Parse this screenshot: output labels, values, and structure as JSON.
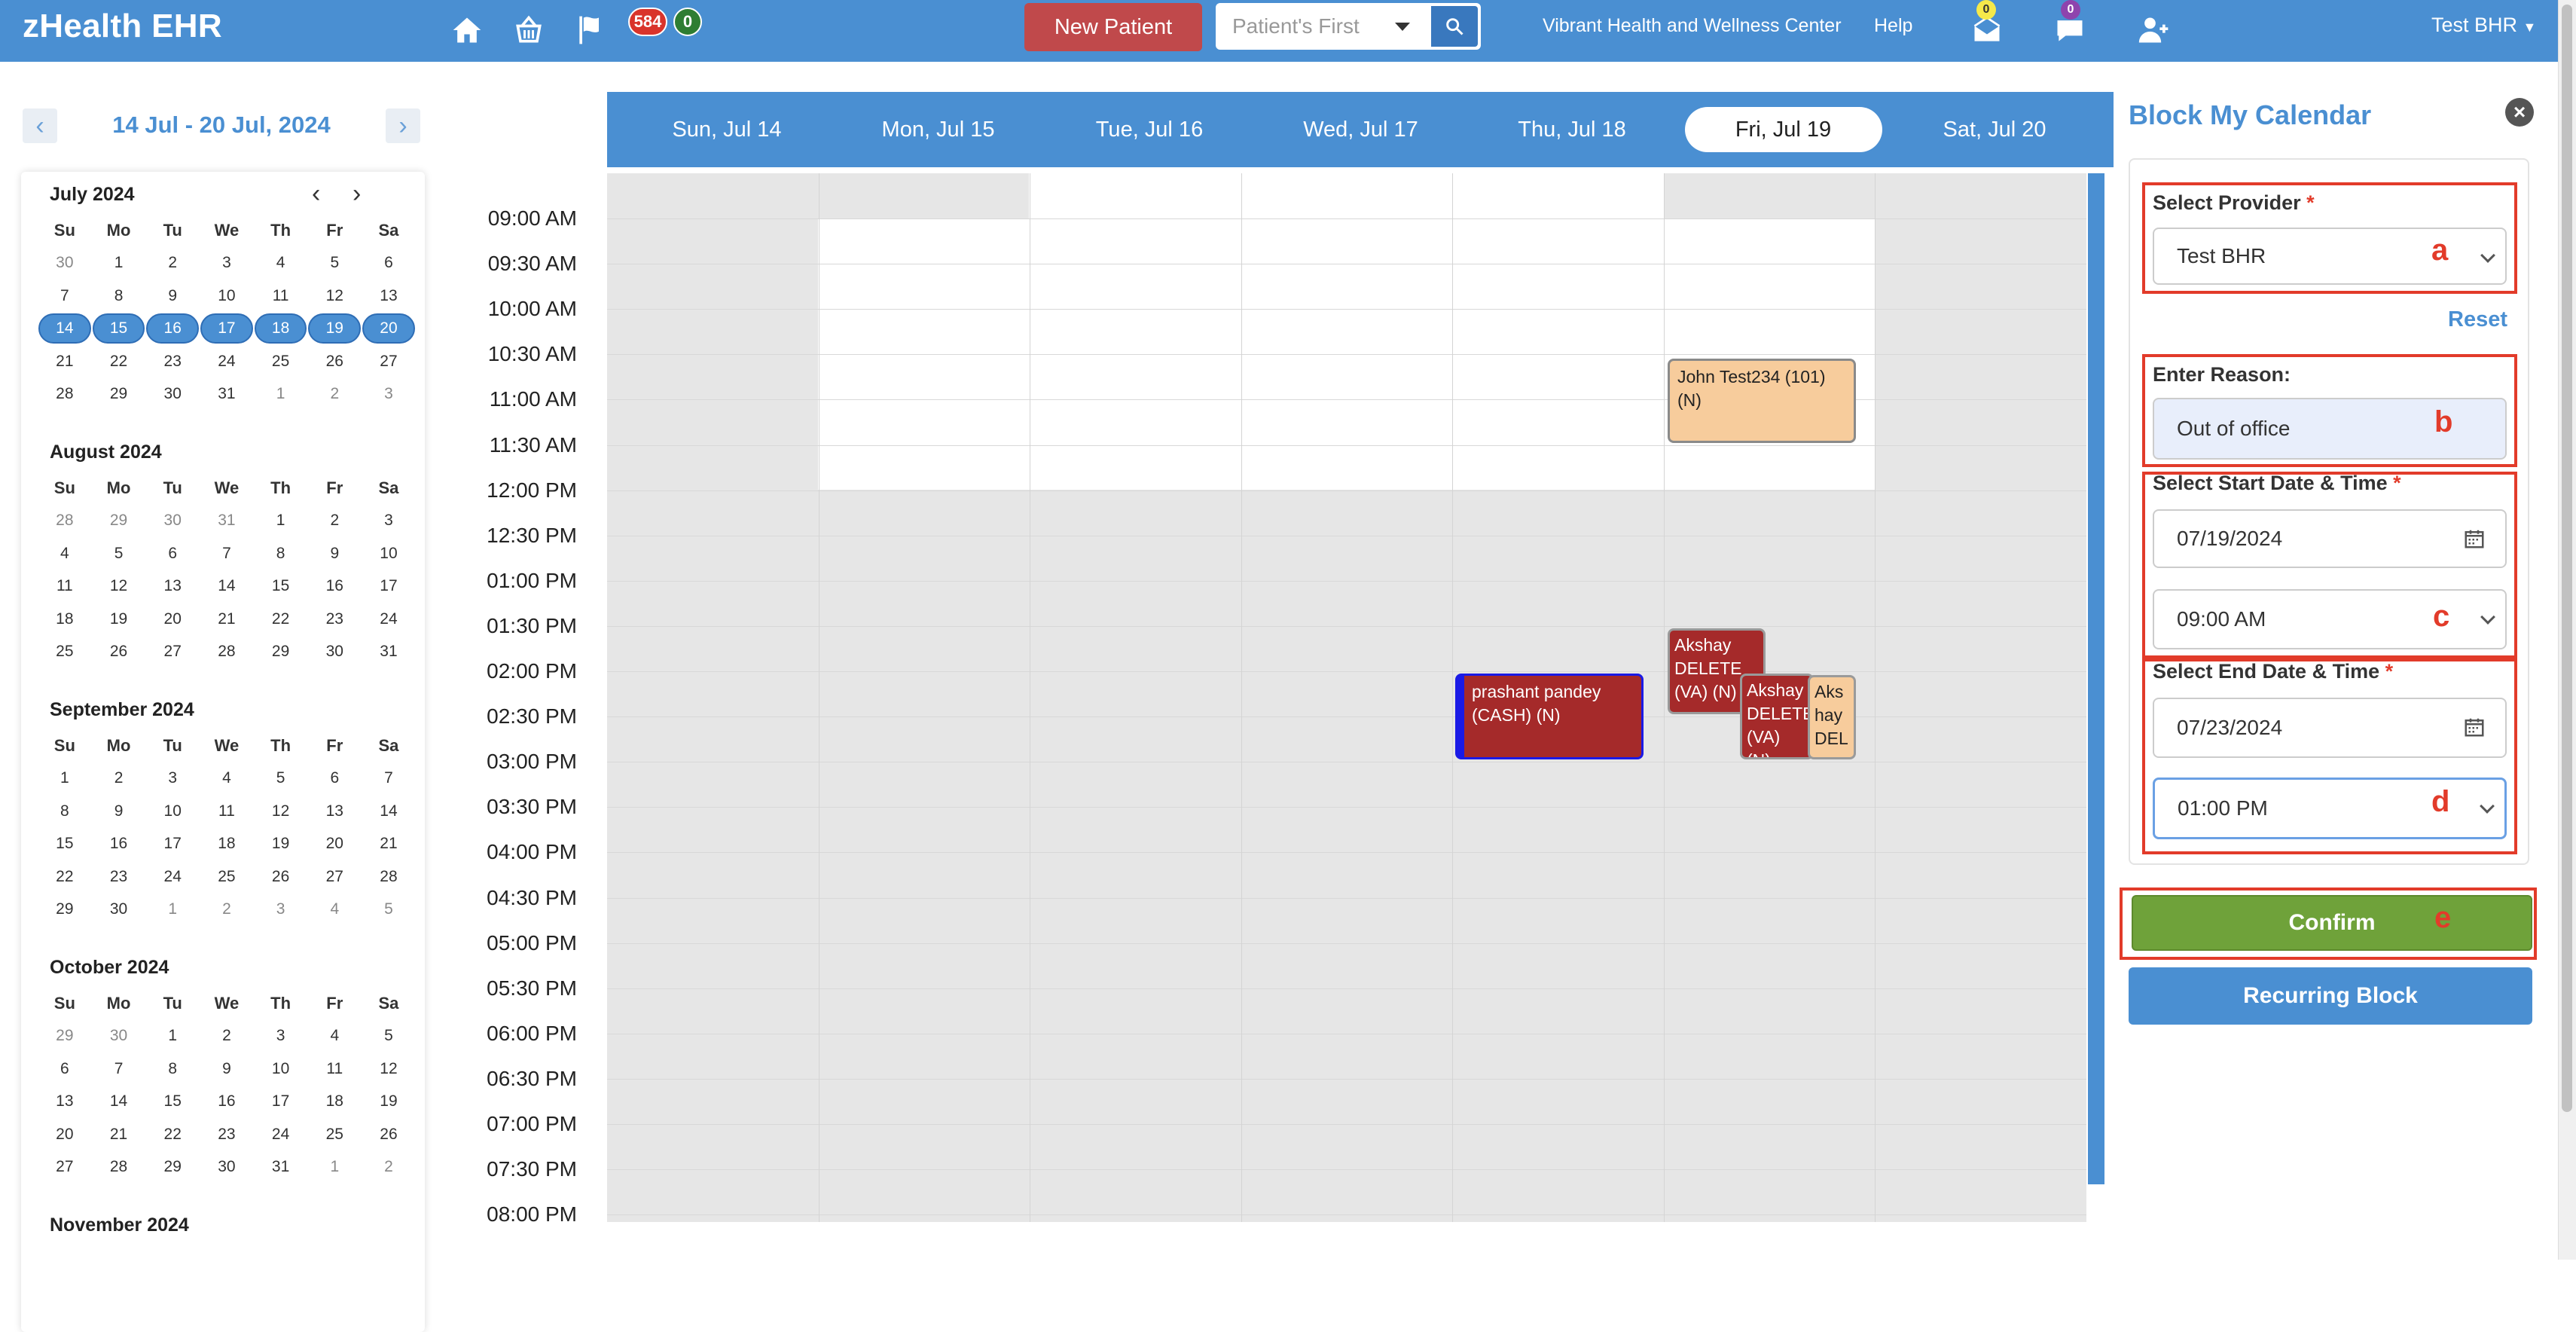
{
  "app": {
    "title": "zHealth EHR"
  },
  "topbar": {
    "badge_red": "584",
    "badge_green": "0",
    "new_patient": "New Patient",
    "search_placeholder": "Patient's First",
    "facility": "Vibrant Health and Wellness Center",
    "help": "Help",
    "mail_count": "0",
    "chat_count": "0",
    "user": "Test BHR",
    "icons": [
      "home-icon",
      "basket-icon",
      "flag-icon",
      "mail-icon",
      "chat-icon",
      "add-user-icon",
      "search-icon"
    ]
  },
  "nav": {
    "range": "14 Jul - 20 Jul, 2024",
    "prev": "‹",
    "next": "›"
  },
  "mini_calendar": {
    "weekdays": [
      "Su",
      "Mo",
      "Tu",
      "We",
      "Th",
      "Fr",
      "Sa"
    ],
    "months": [
      {
        "title": "July 2024",
        "weeks": [
          [
            "30",
            "1",
            "2",
            "3",
            "4",
            "5",
            "6"
          ],
          [
            "7",
            "8",
            "9",
            "10",
            "11",
            "12",
            "13"
          ],
          [
            "14",
            "15",
            "16",
            "17",
            "18",
            "19",
            "20"
          ],
          [
            "21",
            "22",
            "23",
            "24",
            "25",
            "26",
            "27"
          ],
          [
            "28",
            "29",
            "30",
            "31",
            "1",
            "2",
            "3"
          ]
        ]
      },
      {
        "title": "August 2024",
        "weeks": [
          [
            "28",
            "29",
            "30",
            "31",
            "1",
            "2",
            "3"
          ],
          [
            "4",
            "5",
            "6",
            "7",
            "8",
            "9",
            "10"
          ],
          [
            "11",
            "12",
            "13",
            "14",
            "15",
            "16",
            "17"
          ],
          [
            "18",
            "19",
            "20",
            "21",
            "22",
            "23",
            "24"
          ],
          [
            "25",
            "26",
            "27",
            "28",
            "29",
            "30",
            "31"
          ]
        ]
      },
      {
        "title": "September 2024",
        "weeks": [
          [
            "1",
            "2",
            "3",
            "4",
            "5",
            "6",
            "7"
          ],
          [
            "8",
            "9",
            "10",
            "11",
            "12",
            "13",
            "14"
          ],
          [
            "15",
            "16",
            "17",
            "18",
            "19",
            "20",
            "21"
          ],
          [
            "22",
            "23",
            "24",
            "25",
            "26",
            "27",
            "28"
          ],
          [
            "29",
            "30",
            "1",
            "2",
            "3",
            "4",
            "5"
          ]
        ]
      },
      {
        "title": "October 2024",
        "weeks": [
          [
            "29",
            "30",
            "1",
            "2",
            "3",
            "4",
            "5"
          ],
          [
            "6",
            "7",
            "8",
            "9",
            "10",
            "11",
            "12"
          ],
          [
            "13",
            "14",
            "15",
            "16",
            "17",
            "18",
            "19"
          ],
          [
            "20",
            "21",
            "22",
            "23",
            "24",
            "25",
            "26"
          ],
          [
            "27",
            "28",
            "29",
            "30",
            "31",
            "1",
            "2"
          ]
        ]
      },
      {
        "title": "November 2024",
        "weeks": []
      }
    ]
  },
  "week": {
    "days": [
      "Sun, Jul 14",
      "Mon, Jul 15",
      "Tue, Jul 16",
      "Wed, Jul 17",
      "Thu, Jul 18",
      "Fri, Jul 19",
      "Sat, Jul 20"
    ],
    "active_day": "Fri, Jul 19",
    "times": [
      "09:00 AM",
      "09:30 AM",
      "10:00 AM",
      "10:30 AM",
      "11:00 AM",
      "11:30 AM",
      "12:00 PM",
      "12:30 PM",
      "01:00 PM",
      "01:30 PM",
      "02:00 PM",
      "02:30 PM",
      "03:00 PM",
      "03:30 PM",
      "04:00 PM",
      "04:30 PM",
      "05:00 PM",
      "05:30 PM",
      "06:00 PM",
      "06:30 PM",
      "07:00 PM",
      "07:30 PM",
      "08:00 PM"
    ]
  },
  "appointments": [
    {
      "text": "John Test234  (101) (N)"
    },
    {
      "text": "prashant pandey (CASH) (N)"
    },
    {
      "text": "Akshay DELETE (VA) (N)"
    },
    {
      "text": "Akshay DELETE (VA) (N)"
    },
    {
      "text": "Aks hay DEL"
    }
  ],
  "panel": {
    "title": "Block My Calendar",
    "close": "×",
    "provider_label": "Select Provider",
    "provider_value": "Test BHR",
    "reset": "Reset",
    "reason_label": "Enter Reason:",
    "reason_value": "Out of office",
    "start_label": "Select Start Date & Time",
    "start_date": "07/19/2024",
    "start_time": "09:00 AM",
    "end_label": "Select End Date & Time",
    "end_date": "07/23/2024",
    "end_time": "01:00 PM",
    "confirm": "Confirm",
    "recurring": "Recurring Block",
    "required_mark": "*",
    "markers": {
      "a": "a",
      "b": "b",
      "c": "c",
      "d": "d",
      "e": "e"
    }
  }
}
